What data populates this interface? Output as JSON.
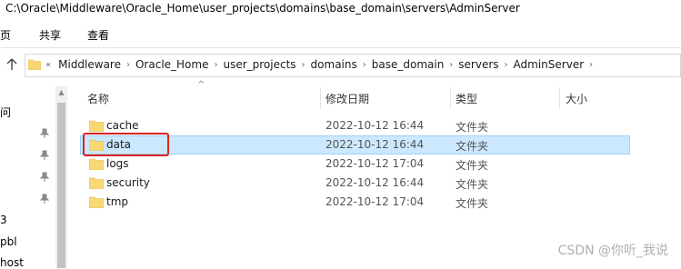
{
  "window": {
    "title": "C:\\Oracle\\Middleware\\Oracle_Home\\user_projects\\domains\\base_domain\\servers\\AdminServer"
  },
  "ribbon": {
    "tabs": [
      "页",
      "共享",
      "查看"
    ]
  },
  "address_bar": {
    "overflow": "«",
    "crumbs": [
      "Middleware",
      "Oracle_Home",
      "user_projects",
      "domains",
      "base_domain",
      "servers",
      "AdminServer"
    ]
  },
  "nav_pane": {
    "items": [
      "问",
      "3",
      "pbl",
      "host"
    ]
  },
  "columns": {
    "name": "名称",
    "modified": "修改日期",
    "type": "类型",
    "size": "大小"
  },
  "files": [
    {
      "name": "cache",
      "modified": "2022-10-12 16:44",
      "type": "文件夹",
      "selected": false
    },
    {
      "name": "data",
      "modified": "2022-10-12 16:44",
      "type": "文件夹",
      "selected": true
    },
    {
      "name": "logs",
      "modified": "2022-10-12 17:04",
      "type": "文件夹",
      "selected": false
    },
    {
      "name": "security",
      "modified": "2022-10-12 16:44",
      "type": "文件夹",
      "selected": false
    },
    {
      "name": "tmp",
      "modified": "2022-10-12 17:04",
      "type": "文件夹",
      "selected": false
    }
  ],
  "watermark": "CSDN @你听_我说",
  "colors": {
    "selection": "#cce8ff",
    "highlight_box": "#e0201f",
    "folder": "#f8d775"
  }
}
